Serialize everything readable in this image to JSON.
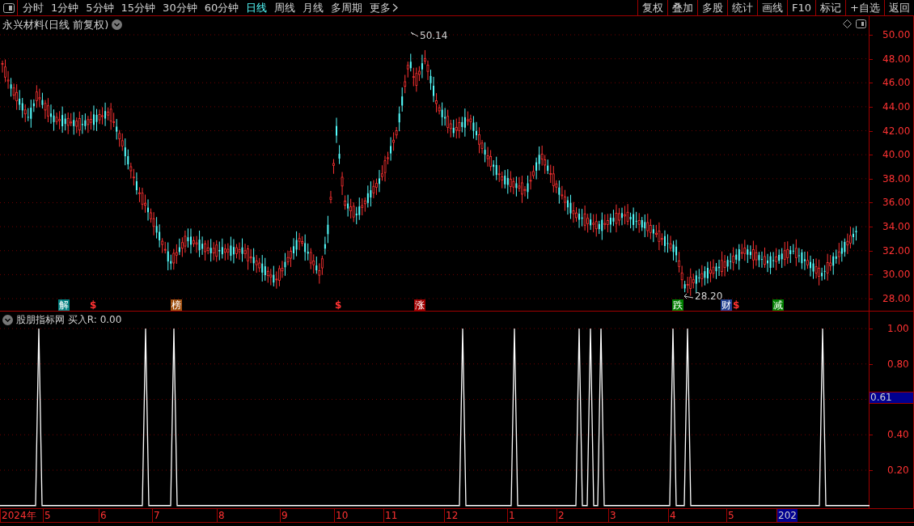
{
  "toolbar": {
    "periods": [
      {
        "label": "分时",
        "selected": false
      },
      {
        "label": "1分钟",
        "selected": false
      },
      {
        "label": "5分钟",
        "selected": false
      },
      {
        "label": "15分钟",
        "selected": false
      },
      {
        "label": "30分钟",
        "selected": false
      },
      {
        "label": "60分钟",
        "selected": false
      },
      {
        "label": "日线",
        "selected": true
      },
      {
        "label": "周线",
        "selected": false
      },
      {
        "label": "月线",
        "selected": false
      },
      {
        "label": "多周期",
        "selected": false
      },
      {
        "label": "更多",
        "selected": false
      }
    ],
    "actions": [
      "复权",
      "叠加",
      "多股",
      "统计",
      "画线",
      "F10",
      "标记",
      "+自选",
      "返回"
    ]
  },
  "main_chart": {
    "title": "永兴材料(日线 前复权)",
    "high_label": "50.14",
    "low_label": "28.20",
    "price_axis": [
      "50.00",
      "48.00",
      "46.00",
      "44.00",
      "42.00",
      "40.00",
      "38.00",
      "36.00",
      "34.00",
      "32.00",
      "30.00",
      "28.00"
    ],
    "markers": [
      {
        "text": "解",
        "kind": "tag",
        "color": "#008080"
      },
      {
        "text": "$",
        "kind": "symbol",
        "color": "#ff3232"
      },
      {
        "text": "榜",
        "kind": "tag",
        "color": "#a05010"
      },
      {
        "text": "$",
        "kind": "symbol",
        "color": "#ff3232"
      },
      {
        "text": "涨",
        "kind": "tag",
        "color": "#a00000"
      },
      {
        "text": "跌",
        "kind": "tag",
        "color": "#008000"
      },
      {
        "text": "财",
        "kind": "tag",
        "color": "#204090"
      },
      {
        "text": "$",
        "kind": "symbol",
        "color": "#ff3232"
      },
      {
        "text": "减",
        "kind": "tag",
        "color": "#008000"
      }
    ]
  },
  "indicator": {
    "title": "股朋指标网 买入R: 0.00",
    "axis": [
      "1.00",
      "0.80",
      "0.40",
      "0.20"
    ],
    "current_value": "0.61"
  },
  "date_axis": [
    {
      "label": "2024年",
      "highlighted": false
    },
    {
      "label": "5",
      "highlighted": false
    },
    {
      "label": "6",
      "highlighted": false
    },
    {
      "label": "7",
      "highlighted": false
    },
    {
      "label": "8",
      "highlighted": false
    },
    {
      "label": "9",
      "highlighted": false
    },
    {
      "label": "10",
      "highlighted": false
    },
    {
      "label": "11",
      "highlighted": false
    },
    {
      "label": "12",
      "highlighted": false
    },
    {
      "label": "1",
      "highlighted": false
    },
    {
      "label": "2",
      "highlighted": false
    },
    {
      "label": "3",
      "highlighted": false
    },
    {
      "label": "4",
      "highlighted": false
    },
    {
      "label": "5",
      "highlighted": false
    },
    {
      "label": "202",
      "highlighted": true
    }
  ]
}
